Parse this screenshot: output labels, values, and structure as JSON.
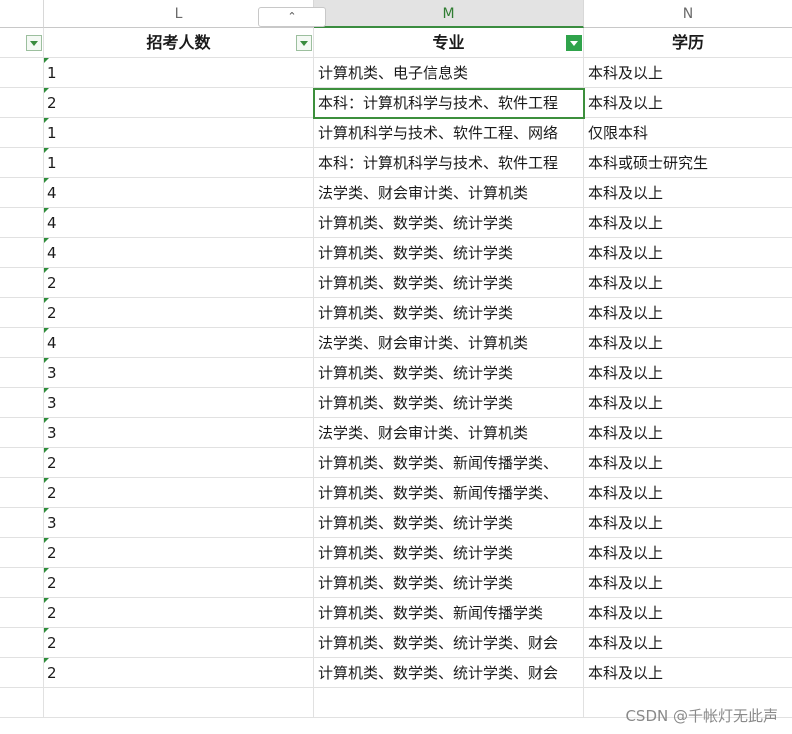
{
  "columns": {
    "L": "L",
    "M": "M",
    "N": "N",
    "collapse_glyph": "⌃"
  },
  "header": {
    "L": "招考人数",
    "M": "专业",
    "N": "学历"
  },
  "rows": [
    {
      "count": "1",
      "major": "计算机类、电子信息类",
      "degree": "本科及以上"
    },
    {
      "count": "2",
      "major": "本科：计算机科学与技术、软件工程",
      "degree": "本科及以上"
    },
    {
      "count": "1",
      "major": "计算机科学与技术、软件工程、网络",
      "degree": "仅限本科"
    },
    {
      "count": "1",
      "major": "本科：计算机科学与技术、软件工程",
      "degree": "本科或硕士研究生"
    },
    {
      "count": "4",
      "major": "法学类、财会审计类、计算机类",
      "degree": "本科及以上"
    },
    {
      "count": "4",
      "major": "计算机类、数学类、统计学类",
      "degree": "本科及以上"
    },
    {
      "count": "4",
      "major": "计算机类、数学类、统计学类",
      "degree": "本科及以上"
    },
    {
      "count": "2",
      "major": "计算机类、数学类、统计学类",
      "degree": "本科及以上"
    },
    {
      "count": "2",
      "major": "计算机类、数学类、统计学类",
      "degree": "本科及以上"
    },
    {
      "count": "4",
      "major": "法学类、财会审计类、计算机类",
      "degree": "本科及以上"
    },
    {
      "count": "3",
      "major": "计算机类、数学类、统计学类",
      "degree": "本科及以上"
    },
    {
      "count": "3",
      "major": "计算机类、数学类、统计学类",
      "degree": "本科及以上"
    },
    {
      "count": "3",
      "major": "法学类、财会审计类、计算机类",
      "degree": "本科及以上"
    },
    {
      "count": "2",
      "major": "计算机类、数学类、新闻传播学类、",
      "degree": "本科及以上"
    },
    {
      "count": "2",
      "major": "计算机类、数学类、新闻传播学类、",
      "degree": "本科及以上"
    },
    {
      "count": "3",
      "major": "计算机类、数学类、统计学类",
      "degree": "本科及以上"
    },
    {
      "count": "2",
      "major": "计算机类、数学类、统计学类",
      "degree": "本科及以上"
    },
    {
      "count": "2",
      "major": "计算机类、数学类、统计学类",
      "degree": "本科及以上"
    },
    {
      "count": "2",
      "major": "计算机类、数学类、新闻传播学类",
      "degree": "本科及以上"
    },
    {
      "count": "2",
      "major": "计算机类、数学类、统计学类、财会",
      "degree": "本科及以上"
    },
    {
      "count": "2",
      "major": "计算机类、数学类、统计学类、财会",
      "degree": "本科及以上"
    }
  ],
  "watermark": "CSDN @千帐灯无此声",
  "colors": {
    "accent_green": "#3a8c3f",
    "filter_active": "#2fa34b"
  }
}
